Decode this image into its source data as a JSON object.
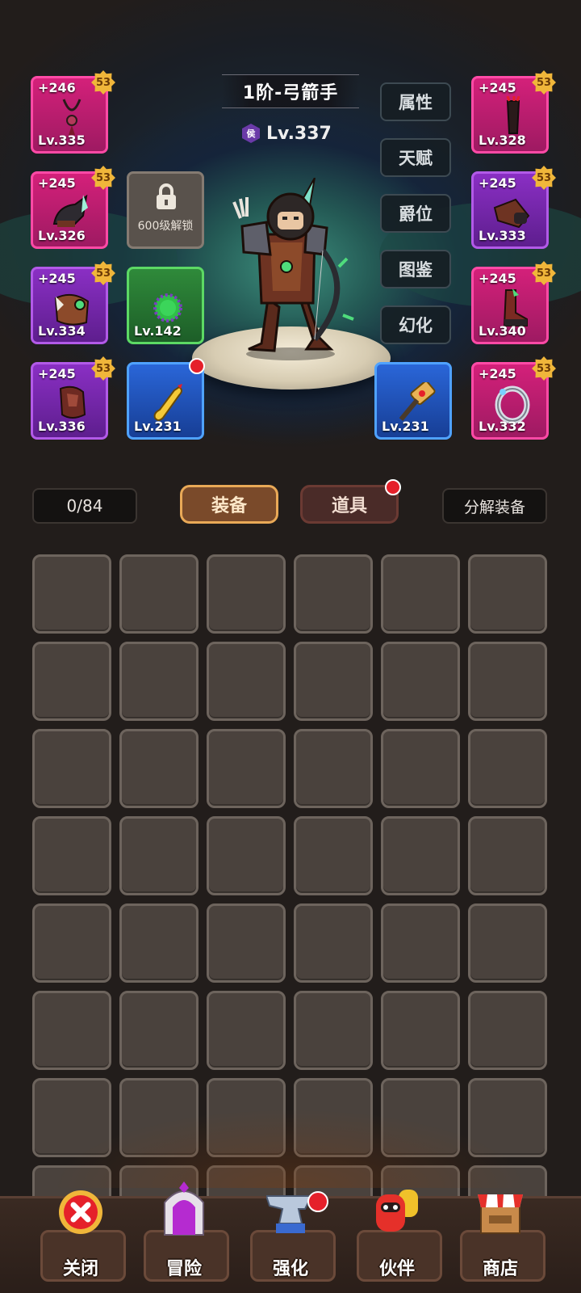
{
  "hero": {
    "class_title": "1阶-弓箭手",
    "rank_badge": "侯",
    "level": "Lv.337"
  },
  "side_menu": [
    {
      "label": "属性"
    },
    {
      "label": "天赋"
    },
    {
      "label": "爵位"
    },
    {
      "label": "图鉴"
    },
    {
      "label": "幻化"
    }
  ],
  "equipment_left": [
    {
      "plus": "+246",
      "level": "Lv.335",
      "stars": "53",
      "rarity": "pink",
      "icon": "necklace-icon"
    },
    {
      "plus": "+245",
      "level": "Lv.326",
      "stars": "53",
      "rarity": "pink",
      "icon": "helmet-icon"
    },
    {
      "plus": "+245",
      "level": "Lv.334",
      "stars": "53",
      "rarity": "purple",
      "icon": "shoulder-armor-icon"
    },
    {
      "plus": "+245",
      "level": "Lv.336",
      "stars": "53",
      "rarity": "purple",
      "icon": "chest-armor-icon"
    }
  ],
  "equipment_right": [
    {
      "plus": "+245",
      "level": "Lv.328",
      "stars": "53",
      "rarity": "pink",
      "icon": "quiver-icon"
    },
    {
      "plus": "+245",
      "level": "Lv.333",
      "stars": "53",
      "rarity": "purple",
      "icon": "gauntlet-icon"
    },
    {
      "plus": "+245",
      "level": "Lv.340",
      "stars": "53",
      "rarity": "pink",
      "icon": "boots-icon"
    },
    {
      "plus": "+245",
      "level": "Lv.332",
      "stars": "53",
      "rarity": "pink",
      "icon": "ring-icon"
    }
  ],
  "extra_slots": {
    "locked_text": "600级解锁",
    "green_level": "Lv.142",
    "chicken_level": "Lv.231",
    "hammer_level": "Lv.231"
  },
  "bag": {
    "count": "0/84",
    "tab_equipment": "装备",
    "tab_items": "道具",
    "decompose": "分解装备"
  },
  "nav": [
    {
      "label": "关闭",
      "icon": "close-icon"
    },
    {
      "label": "冒险",
      "icon": "adventure-gate-icon"
    },
    {
      "label": "强化",
      "icon": "anvil-icon"
    },
    {
      "label": "伙伴",
      "icon": "companion-icon"
    },
    {
      "label": "商店",
      "icon": "shop-icon"
    }
  ],
  "colors": {
    "pink_rarity": "#d4207a",
    "purple_rarity": "#8a2fc4",
    "green_rarity": "#2f8a3a",
    "blue_rarity": "#2a66d8",
    "star_gold": "#f0b63a",
    "notification_red": "#e5202a"
  }
}
